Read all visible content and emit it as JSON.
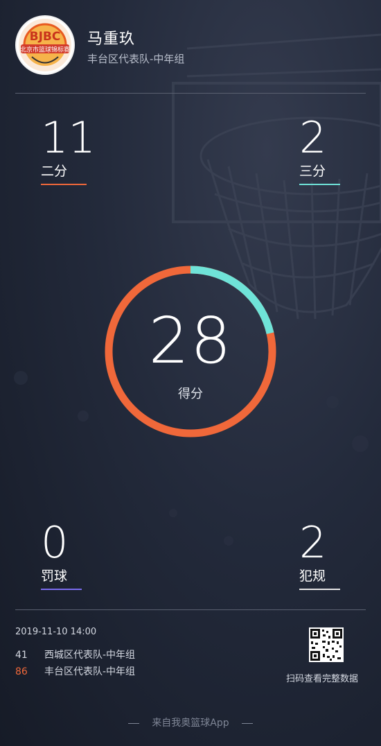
{
  "player": {
    "name": "马重玖",
    "team": "丰台区代表队-中年组",
    "logo_text": "北京市篮球锦标赛",
    "logo_mark": "BJBC"
  },
  "stats": {
    "two_point": {
      "value": "11",
      "label": "二分",
      "color": "#f0683a"
    },
    "three_point": {
      "value": "2",
      "label": "三分",
      "color": "#6fe3d8"
    },
    "free_throw": {
      "value": "0",
      "label": "罚球",
      "color": "#7b6cf0"
    },
    "foul": {
      "value": "2",
      "label": "犯规",
      "color": "#e8e8e8"
    }
  },
  "score": {
    "value": "28",
    "label": "得分",
    "ring_three_share": 0.214,
    "ring_color_main": "#f0683a",
    "ring_color_three": "#6fe3d8"
  },
  "match": {
    "datetime": "2019-11-10 14:00",
    "teams": [
      {
        "score": "41",
        "name": "西城区代表队-中年组",
        "color": "#d5d9e2"
      },
      {
        "score": "86",
        "name": "丰台区代表队-中年组",
        "color": "#f0683a"
      }
    ]
  },
  "qr": {
    "caption": "扫码查看完整数据"
  },
  "footer": {
    "text": "来自我奥篮球App"
  }
}
